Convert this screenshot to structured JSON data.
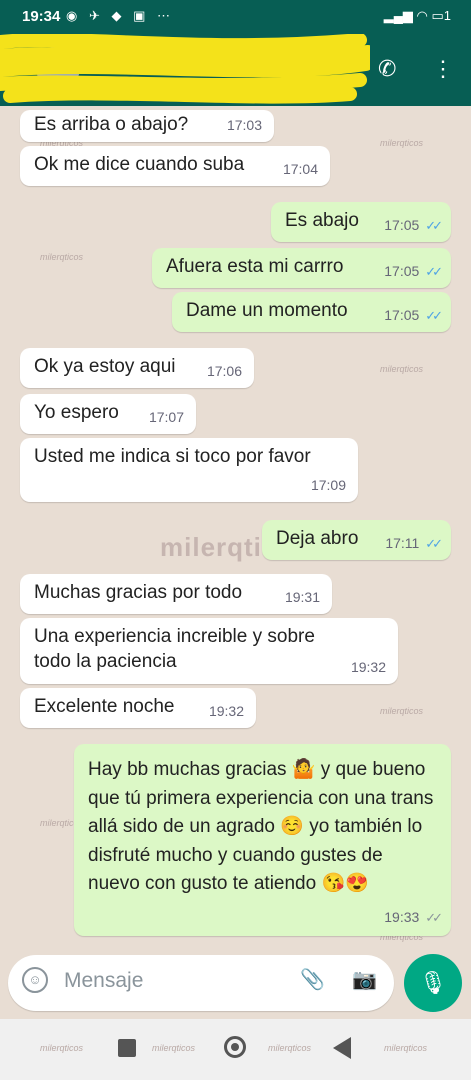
{
  "status_bar": {
    "time": "19:34",
    "battery": "1"
  },
  "app_bar": {
    "contact_name": ""
  },
  "messages": [
    {
      "dir": "in",
      "text": "Es arriba o abajo?",
      "time": "17:03"
    },
    {
      "dir": "in",
      "text": "Ok me dice cuando suba",
      "time": "17:04"
    },
    {
      "dir": "out",
      "text": "Es abajo",
      "time": "17:05",
      "status": "read"
    },
    {
      "dir": "out",
      "text": "Afuera esta mi carrro",
      "time": "17:05",
      "status": "read"
    },
    {
      "dir": "out",
      "text": "Dame un momento",
      "time": "17:05",
      "status": "read"
    },
    {
      "dir": "in",
      "text": "Ok ya estoy aqui",
      "time": "17:06"
    },
    {
      "dir": "in",
      "text": "Yo espero",
      "time": "17:07"
    },
    {
      "dir": "in",
      "text": "Usted me indica si toco por favor",
      "time": "17:09"
    },
    {
      "dir": "out",
      "text": "Deja abro",
      "time": "17:11",
      "status": "read"
    },
    {
      "dir": "in",
      "text": "Muchas gracias por todo",
      "time": "19:31"
    },
    {
      "dir": "in",
      "text": "Una experiencia increible y sobre todo la paciencia",
      "time": "19:32"
    },
    {
      "dir": "in",
      "text": "Excelente noche",
      "time": "19:32"
    },
    {
      "dir": "out",
      "text": "Hay bb muchas gracias 🤷 y que bueno que tú primera experiencia con una trans allá sido de un agrado ☺️ yo también lo disfruté mucho y cuando gustes de nuevo con gusto te atiendo 😘😍",
      "time": "19:33",
      "status": "delivered"
    }
  ],
  "watermark": "milerqticos",
  "center_watermark": "milerqticos",
  "input": {
    "placeholder": "Mensaje"
  },
  "colors": {
    "header": "#075e54",
    "outgoing": "#dcf8c6",
    "incoming": "#ffffff",
    "read_ticks": "#4fa3e5",
    "fab": "#00a884"
  }
}
